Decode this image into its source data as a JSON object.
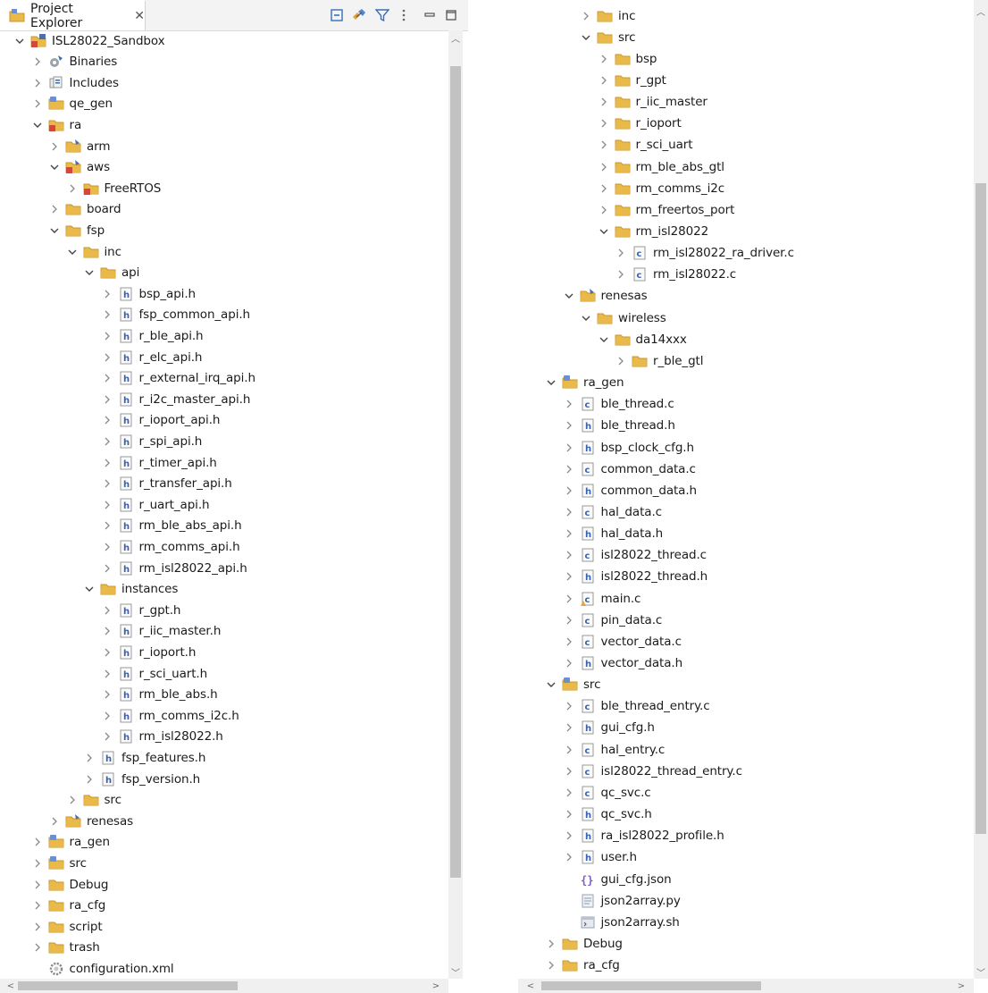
{
  "header": {
    "tab_title": "Project Explorer",
    "close_glyph": "✕"
  },
  "left_tree": [
    {
      "label": "ISL28022_Sandbox",
      "icon": "project",
      "depth": 0,
      "chevron": "down"
    },
    {
      "label": "Binaries",
      "icon": "binaries",
      "depth": 1,
      "chevron": "right"
    },
    {
      "label": "Includes",
      "icon": "includes",
      "depth": 1,
      "chevron": "right"
    },
    {
      "label": "qe_gen",
      "icon": "srcfolder",
      "depth": 1,
      "chevron": "right"
    },
    {
      "label": "ra",
      "icon": "redfolder",
      "depth": 1,
      "chevron": "down"
    },
    {
      "label": "arm",
      "icon": "folderx",
      "depth": 2,
      "chevron": "right"
    },
    {
      "label": "aws",
      "icon": "redfolderx",
      "depth": 2,
      "chevron": "down"
    },
    {
      "label": "FreeRTOS",
      "icon": "redfolder",
      "depth": 3,
      "chevron": "right"
    },
    {
      "label": "board",
      "icon": "folder",
      "depth": 2,
      "chevron": "right"
    },
    {
      "label": "fsp",
      "icon": "folder",
      "depth": 2,
      "chevron": "down"
    },
    {
      "label": "inc",
      "icon": "folder",
      "depth": 3,
      "chevron": "down"
    },
    {
      "label": "api",
      "icon": "folder",
      "depth": 4,
      "chevron": "down"
    },
    {
      "label": "bsp_api.h",
      "icon": "hfile",
      "depth": 5,
      "chevron": "right"
    },
    {
      "label": "fsp_common_api.h",
      "icon": "hfile",
      "depth": 5,
      "chevron": "right"
    },
    {
      "label": "r_ble_api.h",
      "icon": "hfile",
      "depth": 5,
      "chevron": "right"
    },
    {
      "label": "r_elc_api.h",
      "icon": "hfile",
      "depth": 5,
      "chevron": "right"
    },
    {
      "label": "r_external_irq_api.h",
      "icon": "hfile",
      "depth": 5,
      "chevron": "right"
    },
    {
      "label": "r_i2c_master_api.h",
      "icon": "hfile",
      "depth": 5,
      "chevron": "right"
    },
    {
      "label": "r_ioport_api.h",
      "icon": "hfile",
      "depth": 5,
      "chevron": "right"
    },
    {
      "label": "r_spi_api.h",
      "icon": "hfile",
      "depth": 5,
      "chevron": "right"
    },
    {
      "label": "r_timer_api.h",
      "icon": "hfile",
      "depth": 5,
      "chevron": "right"
    },
    {
      "label": "r_transfer_api.h",
      "icon": "hfile",
      "depth": 5,
      "chevron": "right"
    },
    {
      "label": "r_uart_api.h",
      "icon": "hfile",
      "depth": 5,
      "chevron": "right"
    },
    {
      "label": "rm_ble_abs_api.h",
      "icon": "hfile",
      "depth": 5,
      "chevron": "right"
    },
    {
      "label": "rm_comms_api.h",
      "icon": "hfile",
      "depth": 5,
      "chevron": "right"
    },
    {
      "label": "rm_isl28022_api.h",
      "icon": "hfile",
      "depth": 5,
      "chevron": "right"
    },
    {
      "label": "instances",
      "icon": "folder",
      "depth": 4,
      "chevron": "down"
    },
    {
      "label": "r_gpt.h",
      "icon": "hfile",
      "depth": 5,
      "chevron": "right"
    },
    {
      "label": "r_iic_master.h",
      "icon": "hfile",
      "depth": 5,
      "chevron": "right"
    },
    {
      "label": "r_ioport.h",
      "icon": "hfile",
      "depth": 5,
      "chevron": "right"
    },
    {
      "label": "r_sci_uart.h",
      "icon": "hfile",
      "depth": 5,
      "chevron": "right"
    },
    {
      "label": "rm_ble_abs.h",
      "icon": "hfile",
      "depth": 5,
      "chevron": "right"
    },
    {
      "label": "rm_comms_i2c.h",
      "icon": "hfile",
      "depth": 5,
      "chevron": "right"
    },
    {
      "label": "rm_isl28022.h",
      "icon": "hfile",
      "depth": 5,
      "chevron": "right"
    },
    {
      "label": "fsp_features.h",
      "icon": "hfile",
      "depth": 4,
      "chevron": "right"
    },
    {
      "label": "fsp_version.h",
      "icon": "hfile",
      "depth": 4,
      "chevron": "right"
    },
    {
      "label": "src",
      "icon": "folder",
      "depth": 3,
      "chevron": "right"
    },
    {
      "label": "renesas",
      "icon": "folderx",
      "depth": 2,
      "chevron": "right"
    },
    {
      "label": "ra_gen",
      "icon": "srcfolder",
      "depth": 1,
      "chevron": "right"
    },
    {
      "label": "src",
      "icon": "srcfolder",
      "depth": 1,
      "chevron": "right"
    },
    {
      "label": "Debug",
      "icon": "folder",
      "depth": 1,
      "chevron": "right"
    },
    {
      "label": "ra_cfg",
      "icon": "folder",
      "depth": 1,
      "chevron": "right"
    },
    {
      "label": "script",
      "icon": "folder",
      "depth": 1,
      "chevron": "right"
    },
    {
      "label": "trash",
      "icon": "folder",
      "depth": 1,
      "chevron": "right"
    },
    {
      "label": "configuration.xml",
      "icon": "gear",
      "depth": 1,
      "chevron": "none"
    }
  ],
  "right_tree": [
    {
      "label": "inc",
      "icon": "folder",
      "depth": 2,
      "chevron": "right"
    },
    {
      "label": "src",
      "icon": "folder",
      "depth": 2,
      "chevron": "down"
    },
    {
      "label": "bsp",
      "icon": "folder",
      "depth": 3,
      "chevron": "right"
    },
    {
      "label": "r_gpt",
      "icon": "folder",
      "depth": 3,
      "chevron": "right"
    },
    {
      "label": "r_iic_master",
      "icon": "folder",
      "depth": 3,
      "chevron": "right"
    },
    {
      "label": "r_ioport",
      "icon": "folder",
      "depth": 3,
      "chevron": "right"
    },
    {
      "label": "r_sci_uart",
      "icon": "folder",
      "depth": 3,
      "chevron": "right"
    },
    {
      "label": "rm_ble_abs_gtl",
      "icon": "folder",
      "depth": 3,
      "chevron": "right"
    },
    {
      "label": "rm_comms_i2c",
      "icon": "folder",
      "depth": 3,
      "chevron": "right"
    },
    {
      "label": "rm_freertos_port",
      "icon": "folder",
      "depth": 3,
      "chevron": "right"
    },
    {
      "label": "rm_isl28022",
      "icon": "folder",
      "depth": 3,
      "chevron": "down"
    },
    {
      "label": "rm_isl28022_ra_driver.c",
      "icon": "cfile",
      "depth": 4,
      "chevron": "right"
    },
    {
      "label": "rm_isl28022.c",
      "icon": "cfile",
      "depth": 4,
      "chevron": "right"
    },
    {
      "label": "renesas",
      "icon": "folderx",
      "depth": 1,
      "chevron": "down"
    },
    {
      "label": "wireless",
      "icon": "folder",
      "depth": 2,
      "chevron": "down"
    },
    {
      "label": "da14xxx",
      "icon": "folder",
      "depth": 3,
      "chevron": "down"
    },
    {
      "label": "r_ble_gtl",
      "icon": "folder",
      "depth": 4,
      "chevron": "right"
    },
    {
      "label": "ra_gen",
      "icon": "srcfolder",
      "depth": 0,
      "chevron": "down"
    },
    {
      "label": "ble_thread.c",
      "icon": "cfile",
      "depth": 1,
      "chevron": "right"
    },
    {
      "label": "ble_thread.h",
      "icon": "hfile",
      "depth": 1,
      "chevron": "right"
    },
    {
      "label": "bsp_clock_cfg.h",
      "icon": "hfile",
      "depth": 1,
      "chevron": "right"
    },
    {
      "label": "common_data.c",
      "icon": "cfile",
      "depth": 1,
      "chevron": "right"
    },
    {
      "label": "common_data.h",
      "icon": "hfile",
      "depth": 1,
      "chevron": "right"
    },
    {
      "label": "hal_data.c",
      "icon": "cfile",
      "depth": 1,
      "chevron": "right"
    },
    {
      "label": "hal_data.h",
      "icon": "hfile",
      "depth": 1,
      "chevron": "right"
    },
    {
      "label": "isl28022_thread.c",
      "icon": "cfile",
      "depth": 1,
      "chevron": "right"
    },
    {
      "label": "isl28022_thread.h",
      "icon": "hfile",
      "depth": 1,
      "chevron": "right"
    },
    {
      "label": "main.c",
      "icon": "cfilewarn",
      "depth": 1,
      "chevron": "right"
    },
    {
      "label": "pin_data.c",
      "icon": "cfile",
      "depth": 1,
      "chevron": "right"
    },
    {
      "label": "vector_data.c",
      "icon": "cfile",
      "depth": 1,
      "chevron": "right"
    },
    {
      "label": "vector_data.h",
      "icon": "hfile",
      "depth": 1,
      "chevron": "right"
    },
    {
      "label": "src",
      "icon": "srcfolder",
      "depth": 0,
      "chevron": "down"
    },
    {
      "label": "ble_thread_entry.c",
      "icon": "cfile",
      "depth": 1,
      "chevron": "right"
    },
    {
      "label": "gui_cfg.h",
      "icon": "hfile",
      "depth": 1,
      "chevron": "right"
    },
    {
      "label": "hal_entry.c",
      "icon": "cfile",
      "depth": 1,
      "chevron": "right"
    },
    {
      "label": "isl28022_thread_entry.c",
      "icon": "cfile",
      "depth": 1,
      "chevron": "right"
    },
    {
      "label": "qc_svc.c",
      "icon": "cfile",
      "depth": 1,
      "chevron": "right"
    },
    {
      "label": "qc_svc.h",
      "icon": "hfile",
      "depth": 1,
      "chevron": "right"
    },
    {
      "label": "ra_isl28022_profile.h",
      "icon": "hfile",
      "depth": 1,
      "chevron": "right"
    },
    {
      "label": "user.h",
      "icon": "hfile",
      "depth": 1,
      "chevron": "right"
    },
    {
      "label": "gui_cfg.json",
      "icon": "json",
      "depth": 1,
      "chevron": "none"
    },
    {
      "label": "json2array.py",
      "icon": "textfile",
      "depth": 1,
      "chevron": "none"
    },
    {
      "label": "json2array.sh",
      "icon": "shfile",
      "depth": 1,
      "chevron": "none"
    },
    {
      "label": "Debug",
      "icon": "folder",
      "depth": 0,
      "chevron": "right"
    },
    {
      "label": "ra_cfg",
      "icon": "folder",
      "depth": 0,
      "chevron": "right"
    }
  ],
  "colors": {
    "folder": "#e9b949",
    "folder_dark": "#c9962b",
    "src_folder_badge": "#6a8fd4",
    "red_folder": "#d6463c",
    "hfile_letter": "#3a62b0",
    "cfile_letter": "#3a62b0",
    "scroll_track": "#f0f0f0",
    "scroll_thumb": "#c2c2c2"
  }
}
